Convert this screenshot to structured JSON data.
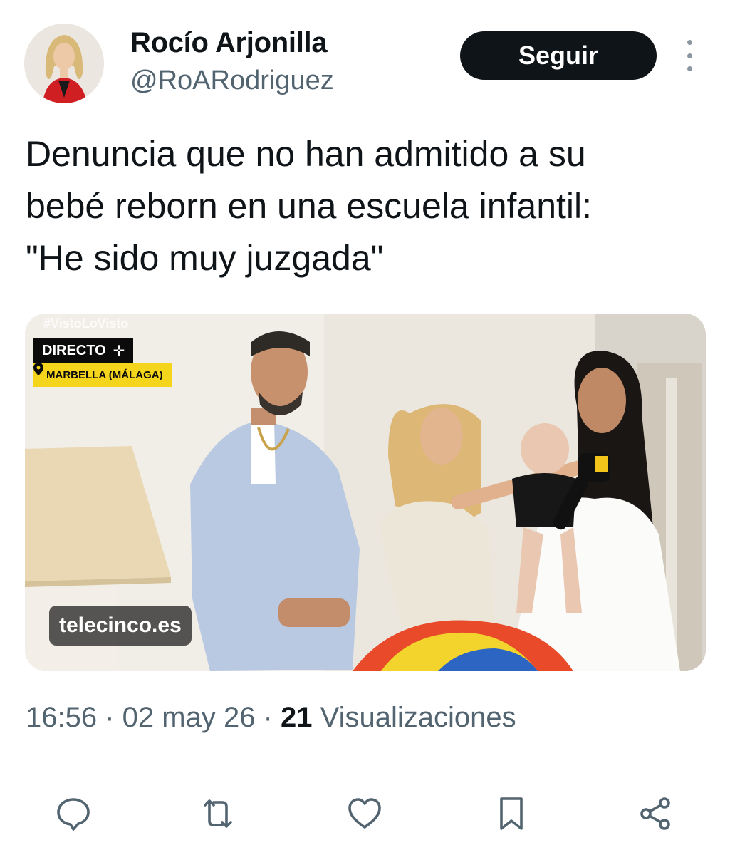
{
  "author": {
    "display_name": "Rocío Arjonilla",
    "handle": "@RoARodriguez"
  },
  "follow_button": {
    "label": "Seguir"
  },
  "tweet": {
    "text": "Denuncia que no han admitido a su\nbebé reborn en una escuela infantil:\n\"He sido muy juzgada\""
  },
  "media": {
    "watermark_hashtag": "#VistoLoVisto",
    "live_label": "DIRECTO",
    "location": "MARBELLA (MÁLAGA)",
    "source": "telecinco.es"
  },
  "meta": {
    "time": "16:56",
    "separator": " · ",
    "date": "02 may 26",
    "views_count": "21",
    "views_label": "Visualizaciones"
  },
  "actions": {
    "reply_icon": "speech-bubble-icon",
    "repost_icon": "repost-arrows-icon",
    "like_icon": "heart-icon",
    "bookmark_icon": "bookmark-icon",
    "share_icon": "share-nodes-icon"
  },
  "colors": {
    "text_primary": "#0f1419",
    "text_secondary": "#536471",
    "follow_bg": "#0f1419",
    "icon": "#536471",
    "live_bg": "#0b0b0b",
    "location_bg": "#f5d41c"
  }
}
